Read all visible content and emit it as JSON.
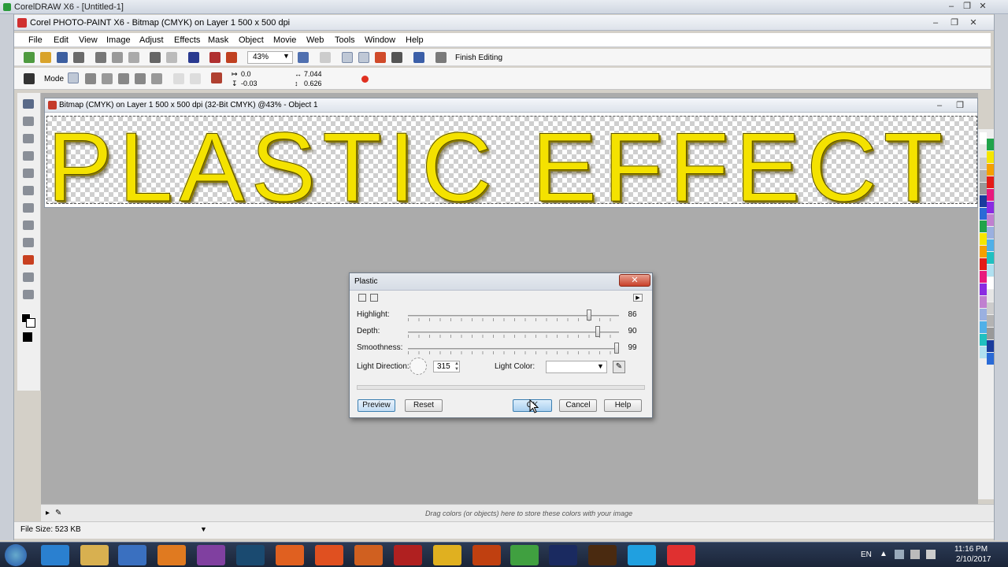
{
  "outer_window": {
    "title": "CorelDRAW X6 - [Untitled-1]"
  },
  "app_window": {
    "title": "Corel PHOTO-PAINT X6 - Bitmap (CMYK) on Layer 1 500 x 500 dpi"
  },
  "menu": [
    "File",
    "Edit",
    "View",
    "Image",
    "Adjust",
    "Effects",
    "Mask",
    "Object",
    "Movie",
    "Web",
    "Tools",
    "Window",
    "Help"
  ],
  "toolbar": {
    "zoom": "43%",
    "finish_editing": "Finish Editing"
  },
  "property_bar": {
    "mode_label": "Mode",
    "x": "0.0",
    "y": "-0.03",
    "w": "7.044",
    "h": "0.626"
  },
  "document": {
    "title": "Bitmap (CMYK) on Layer 1 500 x 500 dpi  (32-Bit CMYK) @43% - Object 1",
    "canvas_text": "PLASTIC EFFECT"
  },
  "dialog": {
    "title": "Plastic",
    "close": "✕",
    "sliders": [
      {
        "label": "Highlight:",
        "value": "86",
        "fraction": 0.86
      },
      {
        "label": "Depth:",
        "value": "90",
        "fraction": 0.9
      },
      {
        "label": "Smoothness:",
        "value": "99",
        "fraction": 0.99
      }
    ],
    "light_direction_label": "Light Direction:",
    "light_direction_value": "315",
    "light_color_label": "Light Color:",
    "buttons": {
      "preview": "Preview",
      "reset": "Reset",
      "ok": "OK",
      "cancel": "Cancel",
      "help": "Help"
    }
  },
  "color_tray_hint": "Drag colors (or objects) here to store these colors with your image",
  "status": {
    "file_size": "File Size: 523 KB"
  },
  "taskbar": {
    "language": "EN",
    "time": "11:16 PM",
    "date": "2/10/2017"
  },
  "palette_colors": [
    "#ffffff",
    "#e6e6e6",
    "#cccccc",
    "#b3b3b3",
    "#999999",
    "#1a3b9c",
    "#2a6ad6",
    "#21a34a",
    "#f5e600",
    "#f5a000",
    "#e41b17",
    "#e8197d",
    "#8a2be2",
    "#c080d0",
    "#9ab0e0",
    "#50b0e8",
    "#20c0c0",
    "#b0e0f0"
  ],
  "colors": {
    "accent": "#3c7fb1",
    "close": "#c8402a",
    "canvas_text": "#f4e200"
  }
}
